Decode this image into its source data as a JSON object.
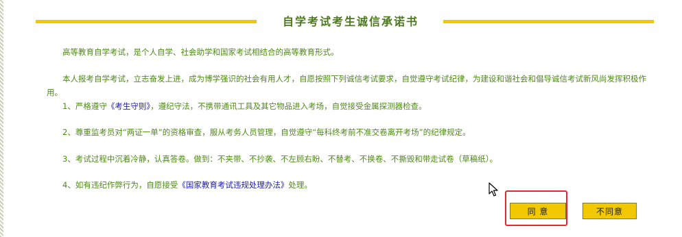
{
  "header": {
    "title": "自学考试考生诚信承诺书"
  },
  "content": {
    "intro": "高等教育自学考试，是个人自学、社会助学和国家考试相结合的高等教育形式。",
    "pledge": "本人报考自学考试，立志奋发上进，成为博学强识的社会有用人才，自愿按照下列诚信考试要求，自觉遵守考试纪律，为建设和谐社会和倡导诚信考试新风尚发挥积极作用。",
    "item1_before": "1、严格遵守",
    "item1_link": "《考生守则》",
    "item1_after": "，遵纪守法，不携带通讯工具及其它物品进入考场，自觉接受金属探测器检查。",
    "item2": "2、尊重监考员对“两证一单”的资格审查，服从考务人员管理，自觉遵守“每科终考前不准交卷离开考场”的纪律规定。",
    "item3": "3、考试过程中沉着冷静，认真答卷。做到：不夹带、不抄袭、不左顾右盼、不替考、不换卷、不撕毁和带走试卷（草稿纸）。",
    "item4_before": "4、如有违纪作弊行为，自愿接受",
    "item4_link": "《国家教育考试违规处理办法》",
    "item4_after": "处理。"
  },
  "buttons": {
    "agree": "同  意",
    "disagree": "不同意"
  },
  "colors": {
    "accent": "#f2c800",
    "text": "#4e8a16",
    "link": "#1a1aaa",
    "highlight": "#e0282e"
  }
}
